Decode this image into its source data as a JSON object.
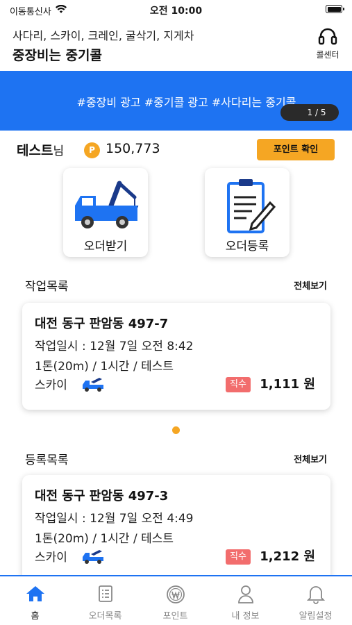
{
  "status_bar": {
    "carrier": "이동통신사",
    "time": "오전 10:00"
  },
  "header": {
    "subtitle": "사다리, 스카이, 크레인, 굴삭기, 지게차",
    "title": "중장비는 중기콜",
    "call_center_label": "콜센터",
    "call_center_icon": "headset-icon"
  },
  "banner": {
    "text": "#중장비 광고 #중기콜 광고 #사다리는 중기콜",
    "pager": "1 / 5",
    "color": "#1e73f2"
  },
  "user": {
    "name": "테스트",
    "name_suffix": "님",
    "point_symbol": "P",
    "points": "150,773",
    "point_button": "포인트 확인",
    "accent": "#f5a623"
  },
  "actions": [
    {
      "label": "오더받기",
      "icon": "tow-truck-icon"
    },
    {
      "label": "오더등록",
      "icon": "clipboard-edit-icon"
    }
  ],
  "work_list": {
    "title": "작업목록",
    "more": "전체보기",
    "items": [
      {
        "address": "대전 동구 판암동 497-7",
        "datetime": "작업일시 : 12월 7일 오전 8:42",
        "spec": "1톤(20m) / 1시간 / 테스트",
        "type": "스카이",
        "badge": "직수",
        "price": "1,111 원"
      }
    ],
    "page_index": 1,
    "page_count": 1
  },
  "register_list": {
    "title": "등록목록",
    "more": "전체보기",
    "items": [
      {
        "address": "대전 동구 판암동 497-3",
        "datetime": "작업일시 : 12월 7일 오전 4:49",
        "spec": "1톤(20m) / 1시간 / 테스트",
        "type": "스카이",
        "badge": "직수",
        "price": "1,212 원"
      }
    ]
  },
  "tabbar": {
    "active": "home",
    "tabs": [
      {
        "label": "홈",
        "icon": "home-icon"
      },
      {
        "label": "오더목록",
        "icon": "list-icon"
      },
      {
        "label": "포인트",
        "icon": "won-coin-icon"
      },
      {
        "label": "내 정보",
        "icon": "person-icon"
      },
      {
        "label": "알림설정",
        "icon": "bell-icon"
      }
    ]
  }
}
